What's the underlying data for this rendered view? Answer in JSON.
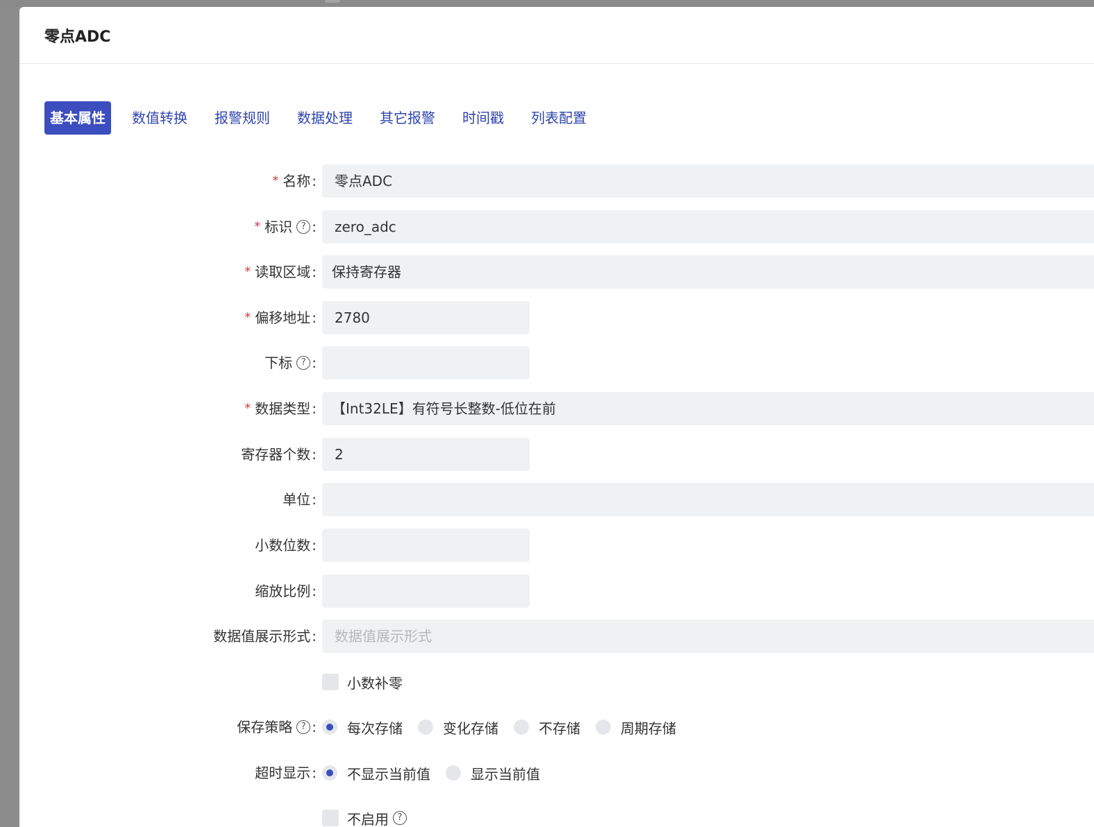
{
  "dialog": {
    "title": "零点ADC"
  },
  "tabs": [
    {
      "label": "基本属性",
      "active": true
    },
    {
      "label": "数值转换",
      "active": false
    },
    {
      "label": "报警规则",
      "active": false
    },
    {
      "label": "数据处理",
      "active": false
    },
    {
      "label": "其它报警",
      "active": false
    },
    {
      "label": "时间戳",
      "active": false
    },
    {
      "label": "列表配置",
      "active": false
    }
  ],
  "form": {
    "name": {
      "label": "名称",
      "required": true,
      "value": "零点ADC"
    },
    "identifier": {
      "label": "标识",
      "required": true,
      "value": "zero_adc"
    },
    "read_area": {
      "label": "读取区域",
      "required": true,
      "value": "保持寄存器"
    },
    "offset": {
      "label": "偏移地址",
      "required": true,
      "value": "2780"
    },
    "index": {
      "label": "下标",
      "required": false,
      "value": ""
    },
    "data_type": {
      "label": "数据类型",
      "required": true,
      "value": "【Int32LE】有符号长整数-低位在前"
    },
    "register_count": {
      "label": "寄存器个数",
      "required": false,
      "value": "2"
    },
    "unit": {
      "label": "单位",
      "required": false,
      "value": ""
    },
    "decimals": {
      "label": "小数位数",
      "required": false,
      "value": ""
    },
    "scale": {
      "label": "缩放比例",
      "required": false,
      "value": ""
    },
    "display_format": {
      "label": "数据值展示形式",
      "required": false,
      "value": "",
      "placeholder": "数据值展示形式"
    },
    "pad_zero": {
      "label": "小数补零",
      "checked": false
    },
    "save_policy": {
      "label": "保存策略",
      "options": [
        "每次存储",
        "变化存储",
        "不存储",
        "周期存储"
      ],
      "selected": "每次存储"
    },
    "timeout_display": {
      "label": "超时显示",
      "options": [
        "不显示当前值",
        "显示当前值"
      ],
      "selected": "不显示当前值"
    },
    "disable": {
      "label": "不启用",
      "checked": false
    }
  },
  "colors": {
    "accent": "#3b4dbf",
    "tab_text": "#2f45b0",
    "required": "#e0353a",
    "input_bg": "#f0f1f3"
  }
}
